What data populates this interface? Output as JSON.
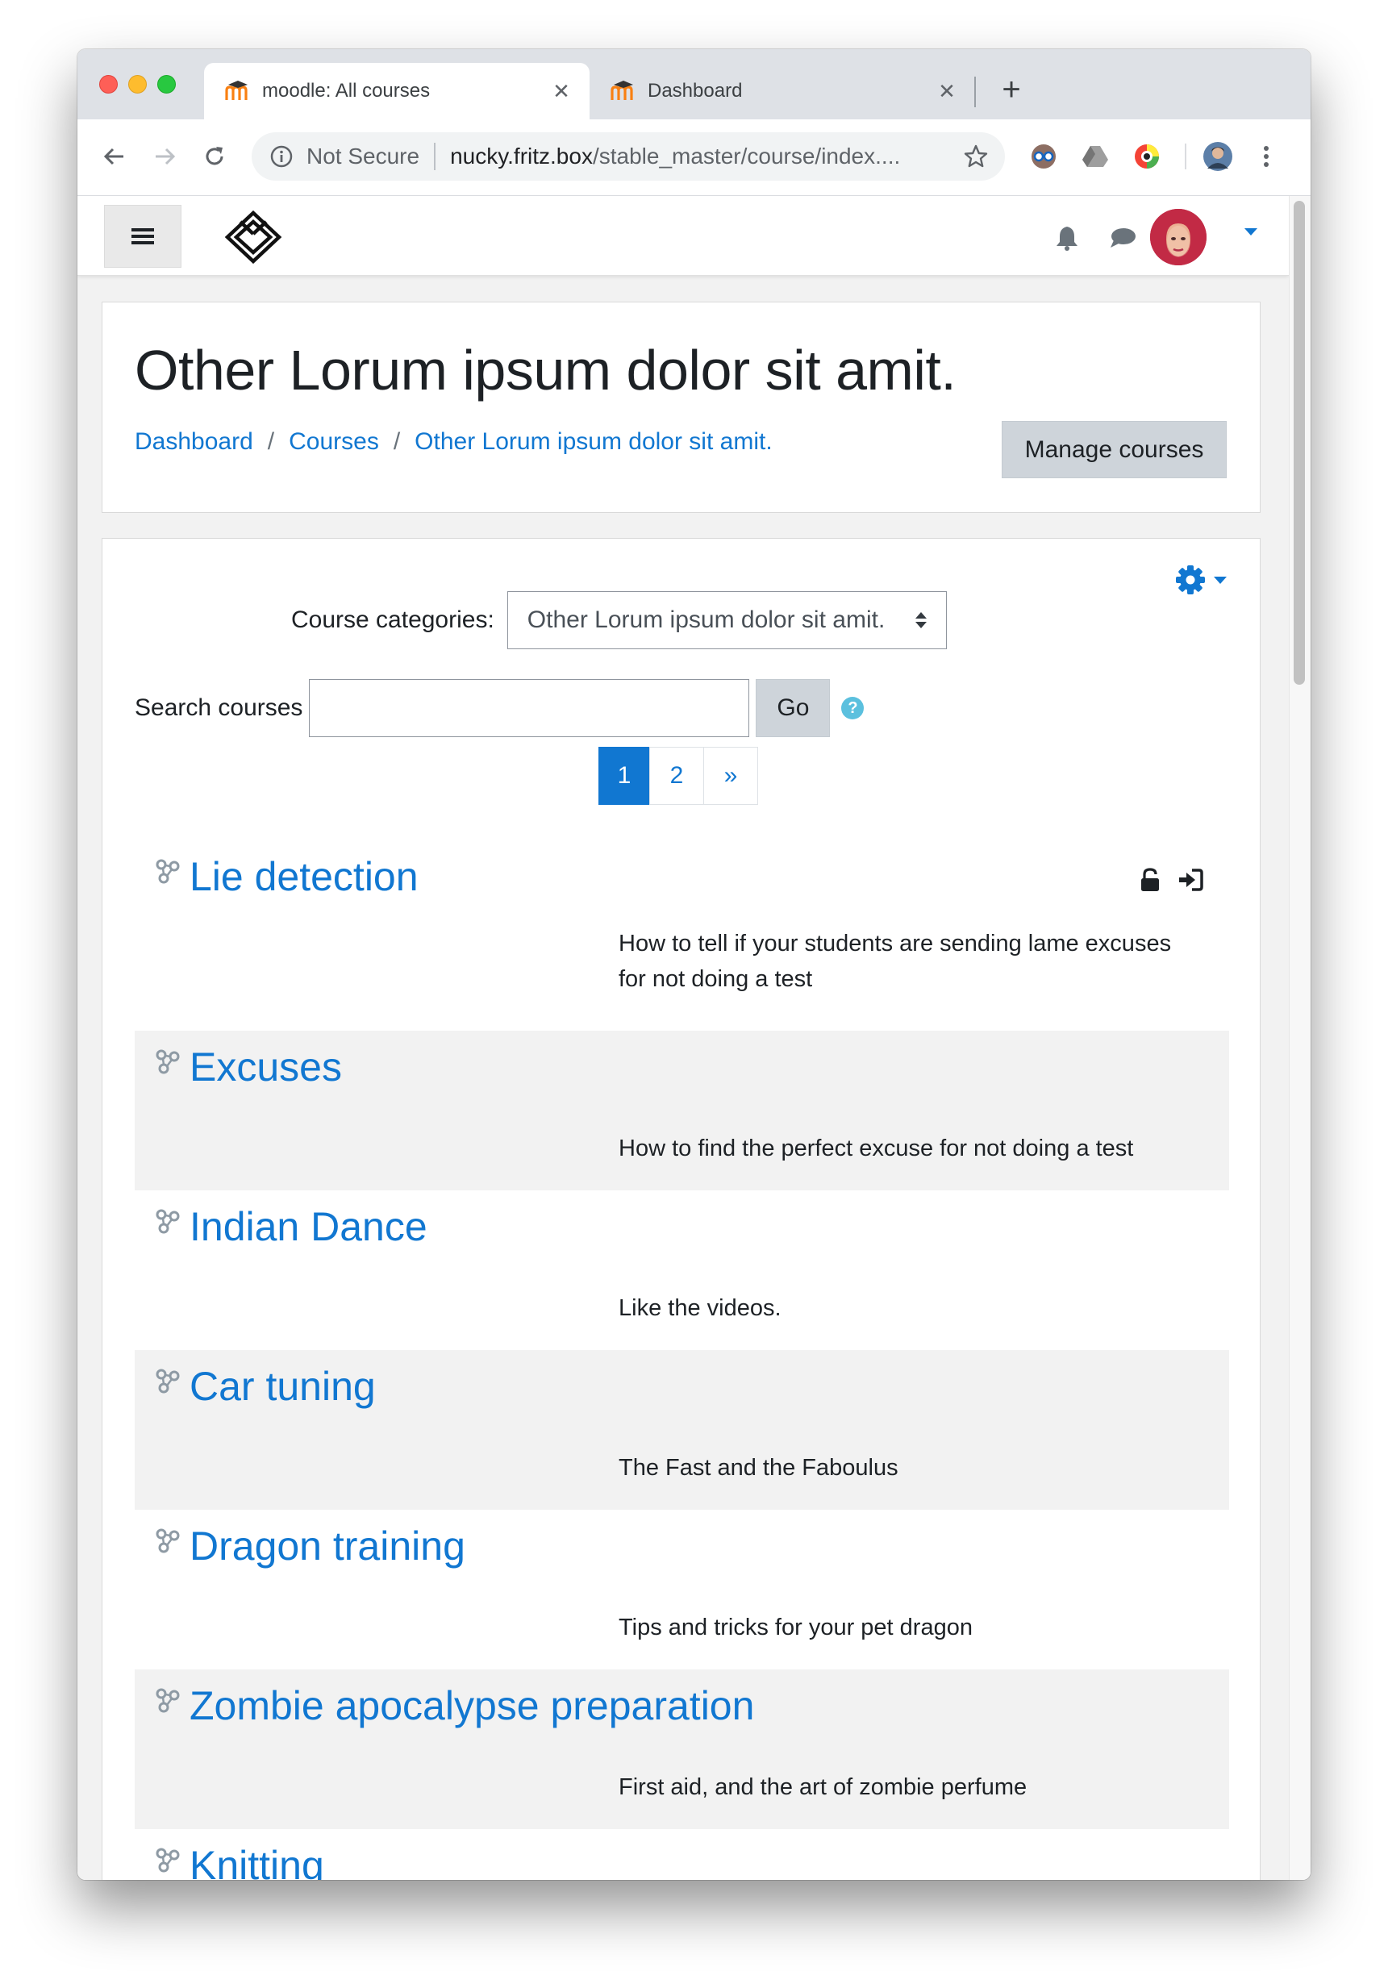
{
  "browser": {
    "tabs": [
      {
        "title": "moodle: All courses",
        "active": true
      },
      {
        "title": "Dashboard",
        "active": false
      }
    ],
    "address": {
      "security_label": "Not Secure",
      "host": "nucky.fritz.box",
      "path": "/stable_master/course/index...."
    }
  },
  "page": {
    "title": "Other Lorum ipsum dolor sit amit.",
    "breadcrumb": [
      "Dashboard",
      "Courses",
      "Other Lorum ipsum dolor sit amit."
    ],
    "manage_button": "Manage courses",
    "category_label": "Course categories:",
    "category_selected": "Other Lorum ipsum dolor sit amit.",
    "search_label": "Search courses",
    "search_value": "",
    "go_button": "Go",
    "pagination": [
      "1",
      "2",
      "»"
    ],
    "courses": [
      {
        "name": "Lie detection",
        "summary": "How to tell if your students are sending lame excuses for not doing a test"
      },
      {
        "name": "Excuses",
        "summary": "How to find the perfect excuse for not doing a test"
      },
      {
        "name": "Indian Dance",
        "summary": "Like the videos."
      },
      {
        "name": "Car tuning",
        "summary": "The Fast and the Faboulus"
      },
      {
        "name": "Dragon training",
        "summary": "Tips and tricks for your pet dragon"
      },
      {
        "name": "Zombie apocalypse preparation",
        "summary": "First aid, and the art of zombie perfume"
      },
      {
        "name": "Knitting",
        "summary": ""
      }
    ]
  },
  "colors": {
    "link": "#1177d1",
    "text": "#1d2125",
    "stripe": "#f2f2f2",
    "button_grey": "#ced4da"
  },
  "icons": {
    "course": "course-sprout-icon",
    "guest_access": "unlock-icon",
    "self_enrol": "sign-in-icon",
    "settings": "gear-icon"
  }
}
